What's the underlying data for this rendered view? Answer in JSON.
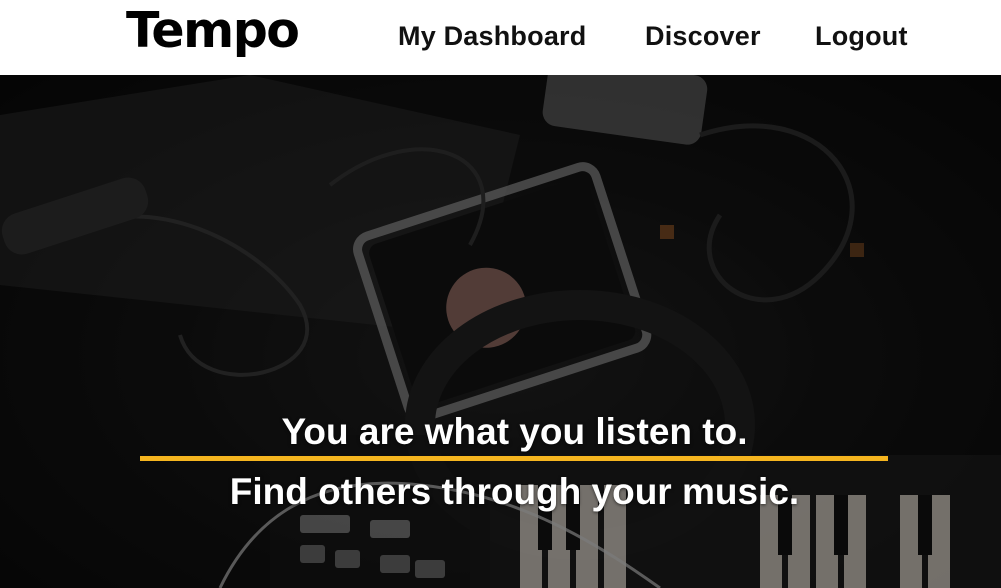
{
  "app": {
    "logo": "Tempo"
  },
  "nav": {
    "links": [
      {
        "label": "My Dashboard"
      },
      {
        "label": "Discover"
      },
      {
        "label": "Logout"
      }
    ]
  },
  "hero": {
    "headline": "You are what you listen to.",
    "subheadline": "Find others through your music.",
    "accent_color": "#f5b51f"
  }
}
